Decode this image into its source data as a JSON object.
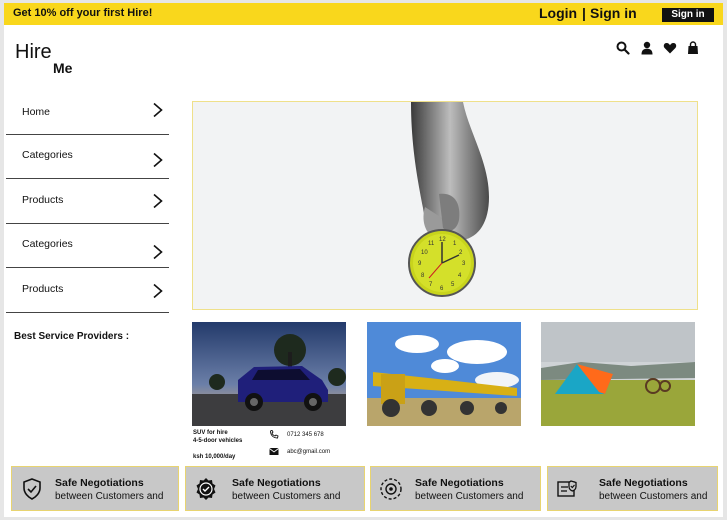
{
  "topbar": {
    "promo": "Get 10% off your first Hire!",
    "login": "Login",
    "separator": "|",
    "signin_link": "Sign in",
    "signin_button": "Sign in"
  },
  "logo": {
    "line1": "Hire",
    "line2": "Me"
  },
  "header_icons": [
    "search-icon",
    "user-icon",
    "heart-icon",
    "bag-icon"
  ],
  "sidebar": {
    "items": [
      {
        "label": "Home"
      },
      {
        "label": "Categories"
      },
      {
        "label": "Products"
      },
      {
        "label": "Categories"
      },
      {
        "label": "Products"
      }
    ],
    "best_heading": "Best Service Providers :"
  },
  "listing": {
    "title_line1": "SUV for hire",
    "title_line2": "4-5-door vehicles",
    "price": "ksh 10,000/day",
    "phone": "0712 345 678",
    "email": "abc@gmail.com"
  },
  "features": [
    {
      "title": "Safe Negotiations",
      "subtitle": "between Customers and",
      "icon": "shield-check-icon"
    },
    {
      "title": "Safe Negotiations",
      "subtitle": "between Customers and",
      "icon": "badge-check-icon"
    },
    {
      "title": "Safe Negotiations",
      "subtitle": "between Customers and",
      "icon": "gear-hand-icon"
    },
    {
      "title": "Safe Negotiations",
      "subtitle": "between Customers and",
      "icon": "certificate-icon"
    }
  ],
  "colors": {
    "accent": "#f9d71c",
    "dark": "#111111",
    "feature_bg": "#c8c8c8"
  }
}
